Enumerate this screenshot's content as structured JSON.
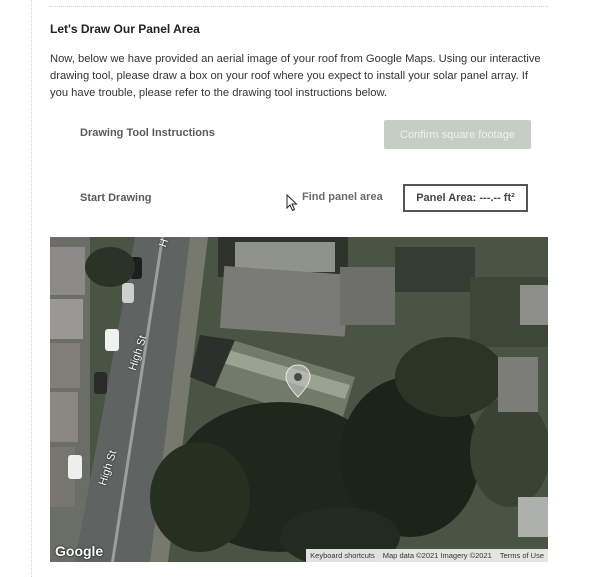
{
  "section": {
    "title": "Let's Draw Our Panel Area",
    "description": "Now, below we have provided an aerial image of your roof from Google Maps. Using our interactive drawing tool, please draw a box on your roof where you expect to install your solar panel array. If you have trouble, please refer to the drawing tool instructions below."
  },
  "toolbar": {
    "instructions_label": "Drawing Tool Instructions",
    "confirm_label": "Confirm square footage",
    "start_label": "Start Drawing",
    "find_label": "Find panel area",
    "panel_area_label": "Panel Area: ---.-- ft²"
  },
  "map": {
    "logo_text": "Google",
    "street_labels": [
      "High St",
      "High St",
      "H"
    ],
    "attribution": {
      "shortcuts": "Keyboard shortcuts",
      "data": "Map data ©2021 Imagery ©2021",
      "terms": "Terms of Use"
    }
  },
  "colors": {
    "confirm_bg": "#c5cdc5",
    "tree_dark": "#1f271c",
    "road": "#5f6361"
  }
}
